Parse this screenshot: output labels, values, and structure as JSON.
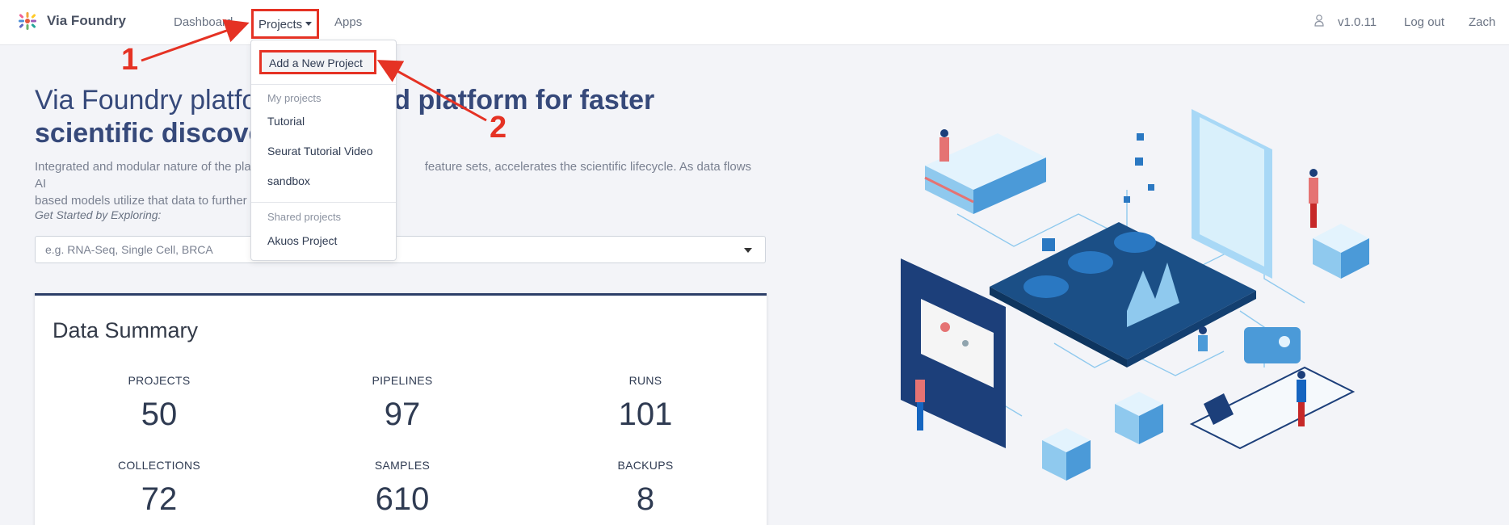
{
  "navbar": {
    "brand": "Via Foundry",
    "links": {
      "dashboard": "Dashboard",
      "projects": "Projects",
      "apps": "Apps"
    },
    "version": "v1.0.11",
    "logout": "Log out",
    "user": "Zach"
  },
  "dropdown": {
    "add_new": "Add a New Project",
    "my_projects_header": "My projects",
    "my_projects": [
      "Tutorial",
      "Seurat Tutorial Video",
      "sandbox"
    ],
    "shared_projects_header": "Shared projects",
    "shared_projects": [
      "Akuos Project"
    ]
  },
  "annotations": {
    "step1": "1",
    "step2": "2"
  },
  "hero": {
    "title_left": "Via Foundry platfo",
    "title_right": "ed platform for faster",
    "title_line2": "scientific discove",
    "desc_line1_left": "Integrated and modular nature of the pla",
    "desc_line1_right": "feature sets, accelerates the scientific lifecycle. As data flows AI",
    "desc_line2_left": "based models utilize that data to further",
    "explore_label": "Get Started by Exploring:",
    "search_placeholder": "e.g. RNA-Seq, Single Cell, BRCA"
  },
  "summary": {
    "title": "Data Summary",
    "stats": [
      {
        "label": "PROJECTS",
        "value": "50"
      },
      {
        "label": "PIPELINES",
        "value": "97"
      },
      {
        "label": "RUNS",
        "value": "101"
      },
      {
        "label": "COLLECTIONS",
        "value": "72"
      },
      {
        "label": "SAMPLES",
        "value": "610"
      },
      {
        "label": "BACKUPS",
        "value": "8"
      }
    ]
  },
  "colors": {
    "accent": "#36497a",
    "annotation_red": "#e53224",
    "card_border": "#2c3e68",
    "page_bg": "#f3f4f8"
  }
}
